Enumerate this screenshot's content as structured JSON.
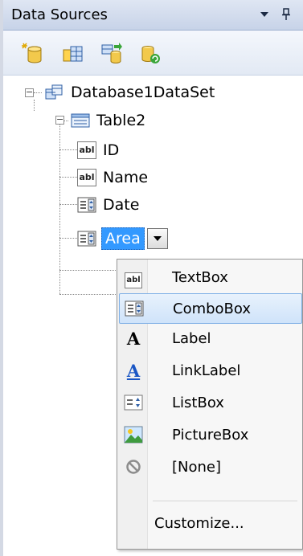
{
  "panel": {
    "title": "Data Sources",
    "dropdown_glyph": "▾",
    "pin_glyph": "⊥"
  },
  "toolbar": {
    "buttons": [
      {
        "name": "add-new-data-source",
        "icon": "add-data-source-icon"
      },
      {
        "name": "edit-dataset-with-designer",
        "icon": "edit-dataset-icon"
      },
      {
        "name": "configure-dataset-with-wizard",
        "icon": "configure-wizard-icon"
      },
      {
        "name": "refresh",
        "icon": "refresh-icon"
      }
    ]
  },
  "tree": {
    "dataset": "Database1DataSet",
    "table": "Table2",
    "fields": [
      {
        "label": "ID",
        "icon": "textbox-icon"
      },
      {
        "label": "Name",
        "icon": "textbox-icon"
      },
      {
        "label": "Date",
        "icon": "combobox-icon"
      },
      {
        "label": "Area",
        "icon": "combobox-icon",
        "selected": true
      }
    ],
    "expander_minus": "−"
  },
  "menu": {
    "items": [
      {
        "label": "TextBox",
        "icon": "textbox-icon"
      },
      {
        "label": "ComboBox",
        "icon": "combobox-icon",
        "highlighted": true
      },
      {
        "label": "Label",
        "icon": "label-icon"
      },
      {
        "label": "LinkLabel",
        "icon": "linklabel-icon"
      },
      {
        "label": "ListBox",
        "icon": "listbox-icon"
      },
      {
        "label": "PictureBox",
        "icon": "picturebox-icon"
      },
      {
        "label": "[None]",
        "icon": "none-icon"
      }
    ],
    "customize": "Customize...",
    "icon_glyphs": {
      "textbox": "abl",
      "label": "A",
      "linklabel": "A"
    }
  },
  "colors": {
    "selection": "#3399ff",
    "menu_highlight_border": "#7fb0e6",
    "title_bar": "#c7d3e8"
  }
}
